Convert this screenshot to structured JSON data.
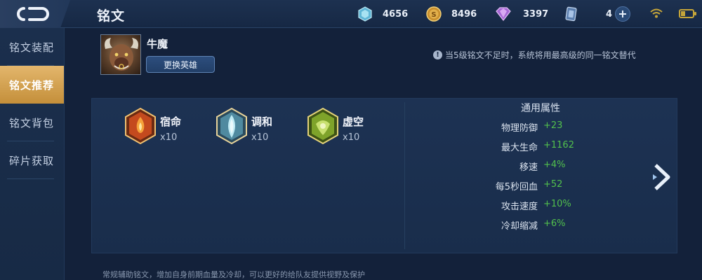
{
  "header": {
    "title": "铭文",
    "currencies": [
      {
        "icon": "diamond-icon",
        "value": "4656",
        "color": "#7fd1e8"
      },
      {
        "icon": "gold-coin-icon",
        "value": "8496",
        "color": "#d8a94a"
      },
      {
        "icon": "gem-icon",
        "value": "3397",
        "color": "#c58ae8"
      },
      {
        "icon": "rune-shard-icon",
        "value": "4",
        "color": "#8fb3e0"
      }
    ]
  },
  "sidebar": {
    "items": [
      {
        "label": "铭文装配",
        "active": false
      },
      {
        "label": "铭文推荐",
        "active": true
      },
      {
        "label": "铭文背包",
        "active": false
      },
      {
        "label": "碎片获取",
        "active": false
      }
    ]
  },
  "hero": {
    "name": "牛魔",
    "change_button": "更换英雄"
  },
  "notice": {
    "icon": "info-icon",
    "text": "当5级铭文不足时，系统将用最高级的同一铭文替代"
  },
  "runes": [
    {
      "name": "宿命",
      "count": "x10",
      "color": "#d8552a"
    },
    {
      "name": "调和",
      "count": "x10",
      "color": "#8fd3e6"
    },
    {
      "name": "虚空",
      "count": "x10",
      "color": "#8fbf3a"
    }
  ],
  "attributes": {
    "title": "通用属性",
    "rows": [
      {
        "label": "物理防御",
        "value": "+23"
      },
      {
        "label": "最大生命",
        "value": "+1162"
      },
      {
        "label": "移速",
        "value": "+4%"
      },
      {
        "label": "每5秒回血",
        "value": "+52"
      },
      {
        "label": "攻击速度",
        "value": "+10%"
      },
      {
        "label": "冷却缩减",
        "value": "+6%"
      }
    ]
  },
  "footer": {
    "note": "常规辅助铭文，增加自身前期血量及冷却，可以更好的给队友提供视野及保护"
  }
}
